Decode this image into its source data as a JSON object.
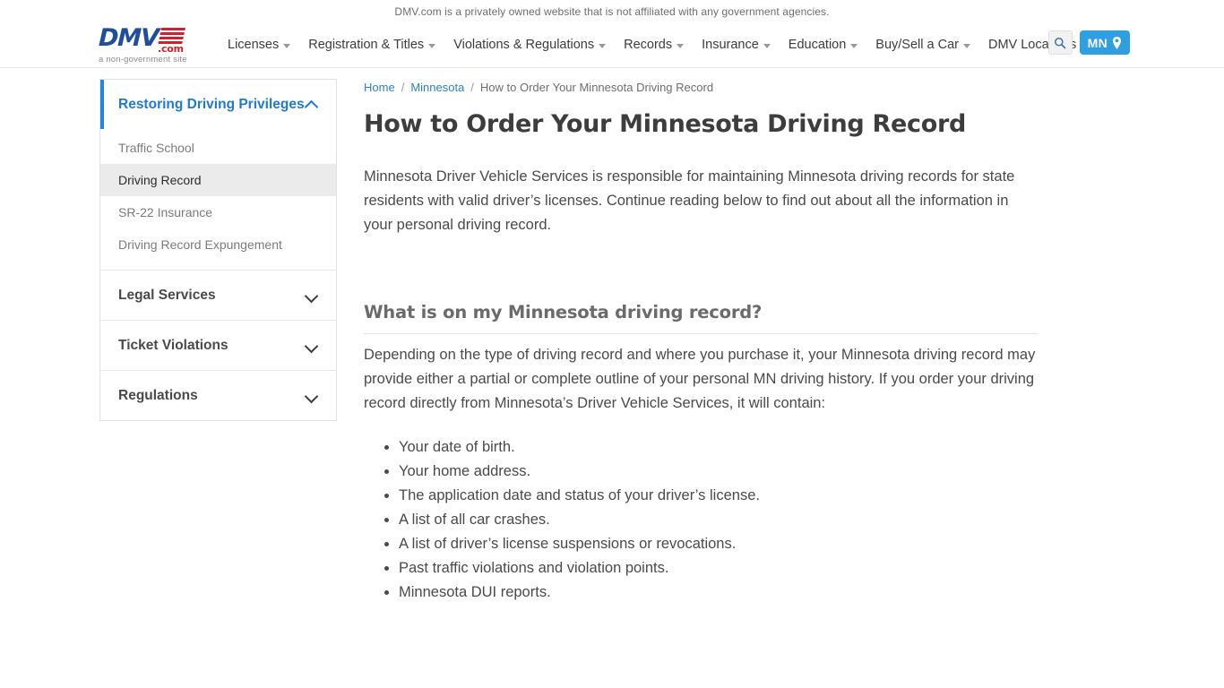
{
  "disclaimer": {
    "text": "DMV.com is a privately owned website that is not affiliated with any government agencies."
  },
  "header": {
    "logo": {
      "wordmark": "DMV",
      "dotcom": ".com",
      "tagline": "a non-government site",
      "brand_blue": "#1f4e9c",
      "brand_red": "#d0202e"
    },
    "nav_items": [
      {
        "label": "Licenses",
        "has_dropdown": true
      },
      {
        "label": "Registration & Titles",
        "has_dropdown": true
      },
      {
        "label": "Violations & Regulations",
        "has_dropdown": true
      },
      {
        "label": "Records",
        "has_dropdown": true
      },
      {
        "label": "Insurance",
        "has_dropdown": true
      },
      {
        "label": "Education",
        "has_dropdown": true
      },
      {
        "label": "Buy/Sell a Car",
        "has_dropdown": true
      },
      {
        "label": "DMV Locations",
        "has_dropdown": false
      }
    ],
    "search_icon": "search-icon",
    "state_button": {
      "label": "MN",
      "icon": "location-pin-icon",
      "color": "#2e9fe0"
    }
  },
  "sidebar": {
    "accent_color": "#2486e0",
    "sections": [
      {
        "label": "Restoring Driving Privileges",
        "expanded": true,
        "chevron": "chevron-up-icon",
        "links": [
          {
            "label": "Traffic School",
            "active": false
          },
          {
            "label": "Driving Record",
            "active": true
          },
          {
            "label": "SR-22 Insurance",
            "active": false
          },
          {
            "label": "Driving Record Expungement",
            "active": false
          }
        ]
      },
      {
        "label": "Legal Services",
        "expanded": false,
        "chevron": "chevron-down-icon",
        "links": []
      },
      {
        "label": "Ticket Violations",
        "expanded": false,
        "chevron": "chevron-down-icon",
        "links": []
      },
      {
        "label": "Regulations",
        "expanded": false,
        "chevron": "chevron-down-icon",
        "links": []
      }
    ]
  },
  "breadcrumb": {
    "items": [
      {
        "label": "Home",
        "link": true
      },
      {
        "label": "Minnesota",
        "link": true
      },
      {
        "label": "How to Order Your Minnesota Driving Record",
        "link": false
      }
    ],
    "separator": "/"
  },
  "main": {
    "title": "How to Order Your Minnesota Driving Record",
    "intro_paragraph": "Minnesota Driver Vehicle Services is responsible for maintaining Minnesota driving records for state residents with valid driver’s licenses. Continue reading below to find out about all the information in your personal driving record.",
    "section_heading": "What is on my Minnesota driving record?",
    "section_paragraph": "Depending on the type of driving record and where you purchase it, your Minnesota driving record may provide either a partial or complete outline of your personal MN driving history. If you order your driving record directly from Minnesota’s Driver Vehicle Services, it will contain:",
    "bullets": [
      "Your date of birth.",
      "Your home address.",
      "The application date and status of your driver’s license.",
      "A list of all car crashes.",
      "A list of driver’s license suspensions or revocations.",
      "Past traffic violations and violation points.",
      "Minnesota DUI reports."
    ]
  }
}
